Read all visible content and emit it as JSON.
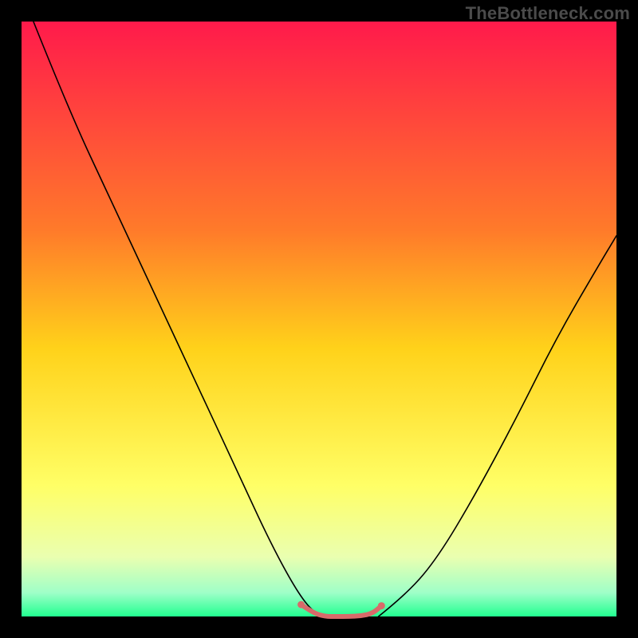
{
  "watermark": "TheBottleneck.com",
  "chart_data": {
    "type": "line",
    "title": "",
    "xlabel": "",
    "ylabel": "",
    "xlim": [
      0,
      100
    ],
    "ylim": [
      0,
      100
    ],
    "grid": false,
    "legend": false,
    "background_gradient": {
      "stops": [
        {
          "offset": 0.0,
          "color": "#ff1a4b"
        },
        {
          "offset": 0.35,
          "color": "#ff7a2a"
        },
        {
          "offset": 0.55,
          "color": "#ffd21a"
        },
        {
          "offset": 0.78,
          "color": "#ffff66"
        },
        {
          "offset": 0.9,
          "color": "#eaffb0"
        },
        {
          "offset": 0.96,
          "color": "#9fffc8"
        },
        {
          "offset": 1.0,
          "color": "#21ff90"
        }
      ]
    },
    "series": [
      {
        "name": "left-arm",
        "color": "#000000",
        "width": 1.6,
        "type": "curve",
        "x": [
          2,
          8,
          15,
          22,
          29,
          36,
          42,
          47,
          50
        ],
        "y": [
          100,
          85,
          70,
          55,
          40,
          25,
          12,
          3,
          0
        ]
      },
      {
        "name": "right-arm",
        "color": "#000000",
        "width": 1.6,
        "type": "curve",
        "x": [
          60,
          65,
          70,
          76,
          83,
          90,
          97,
          100
        ],
        "y": [
          0,
          4,
          10,
          20,
          33,
          47,
          59,
          64
        ]
      },
      {
        "name": "trough-highlight",
        "color": "#d86a6a",
        "width": 6,
        "type": "curve",
        "x": [
          47,
          49,
          51,
          53,
          55,
          57,
          59,
          60.5
        ],
        "y": [
          2.0,
          0.6,
          0.0,
          0.0,
          0.0,
          0.1,
          0.5,
          1.8
        ]
      },
      {
        "name": "trough-end-dots",
        "color": "#d86a6a",
        "type": "scatter",
        "radius": 4.5,
        "x": [
          47,
          60.5
        ],
        "y": [
          2.0,
          1.8
        ]
      }
    ]
  }
}
